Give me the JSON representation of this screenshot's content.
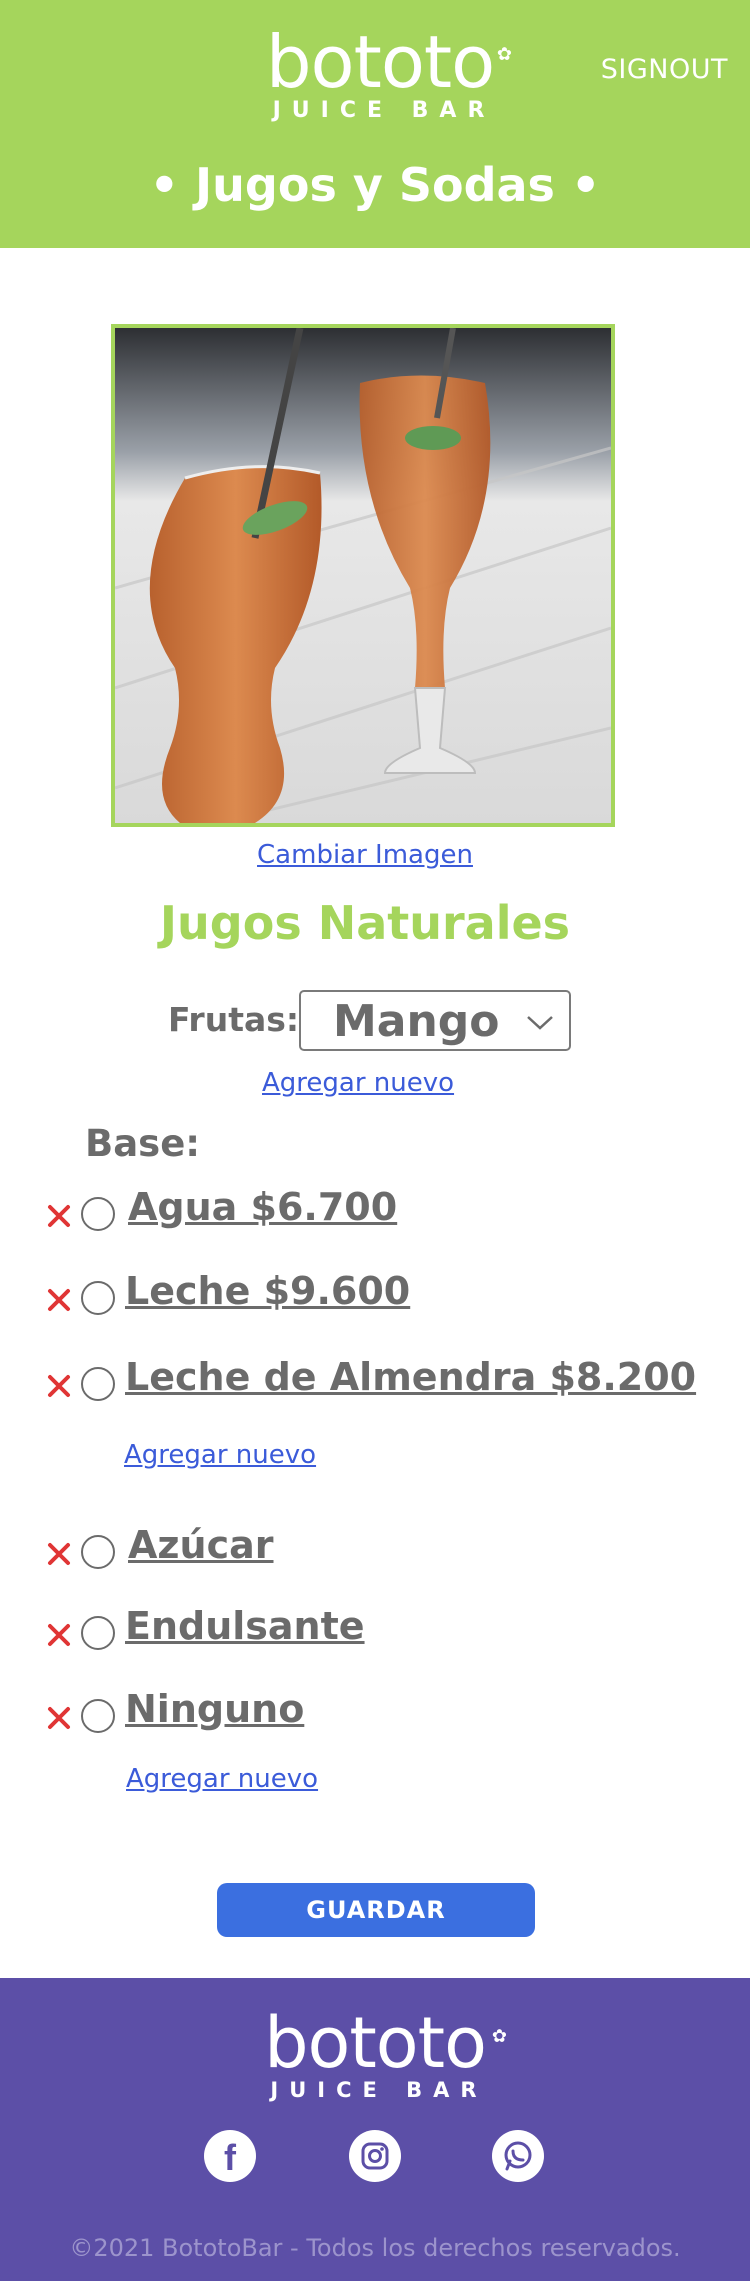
{
  "header": {
    "logo_word": "bototo",
    "logo_sub": "JUICE BAR",
    "signout_label": "SIGNOUT",
    "page_title": "• Jugos y Sodas •"
  },
  "product": {
    "image_alt": "juice glasses",
    "change_image_label": "Cambiar Imagen",
    "title": "Jugos Naturales",
    "fruits_label": "Frutas:",
    "fruit_selected": "Mango",
    "add_fruit_label": "Agregar nuevo"
  },
  "base": {
    "label": "Base:",
    "options": [
      {
        "text": "Agua  $6.700"
      },
      {
        "text": "Leche  $9.600"
      },
      {
        "text": "Leche de Almendra  $8.200"
      }
    ],
    "add_label": "Agregar nuevo"
  },
  "sweetener": {
    "options": [
      {
        "text": "Azúcar"
      },
      {
        "text": "Endulsante"
      },
      {
        "text": "Ninguno"
      }
    ],
    "add_label": "Agregar nuevo"
  },
  "actions": {
    "save_label": "GUARDAR"
  },
  "footer": {
    "logo_word": "bototo",
    "logo_sub": "JUICE BAR",
    "copyright": "©2021 BototoBar - Todos los derechos reservados."
  },
  "colors": {
    "brand_green": "#a5d55c",
    "brand_purple": "#5c4fa7",
    "link_blue": "#3b5bd9",
    "delete_red": "#e03535",
    "button_blue": "#3b6fe0"
  },
  "icons": [
    "gear-icon",
    "chevron-down-icon",
    "delete-icon",
    "facebook-icon",
    "instagram-icon",
    "whatsapp-icon"
  ]
}
